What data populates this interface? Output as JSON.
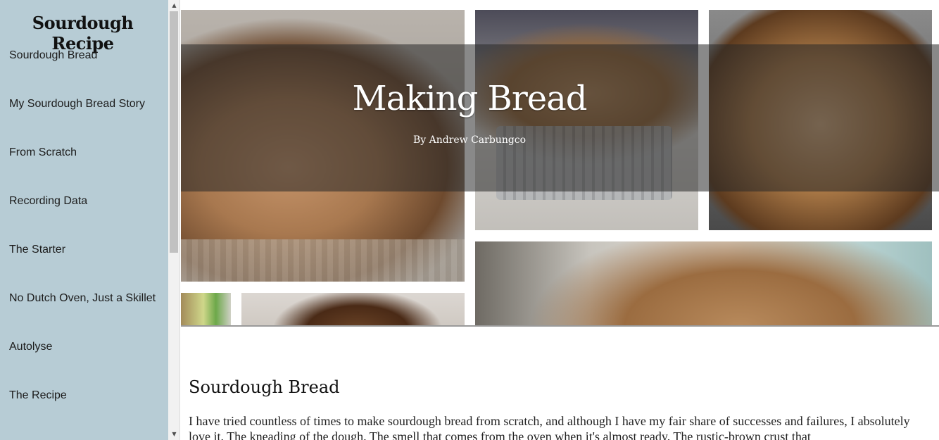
{
  "sidebar": {
    "title": "Sourdough Recipe",
    "items": [
      {
        "label": "Sourdough Bread"
      },
      {
        "label": "My Sourdough Bread Story"
      },
      {
        "label": "From Scratch"
      },
      {
        "label": "Recording Data"
      },
      {
        "label": "The Starter"
      },
      {
        "label": "No Dutch Oven, Just a Skillet"
      },
      {
        "label": "Autolyse"
      },
      {
        "label": "The Recipe"
      }
    ]
  },
  "hero": {
    "title": "Making Bread",
    "byline": "By Andrew Carbungco"
  },
  "content": {
    "section_title": "Sourdough Bread",
    "paragraph": "I have tried countless of times to make sourdough bread from scratch, and although I have my fair share of successes and failures, I absolutely love it. The kneading of the dough. The smell that comes from the oven when it's almost ready. The rustic-brown crust that"
  },
  "colors": {
    "sidebar_bg": "#b7ccd5",
    "banner_overlay": "rgba(40,40,40,0.55)"
  }
}
